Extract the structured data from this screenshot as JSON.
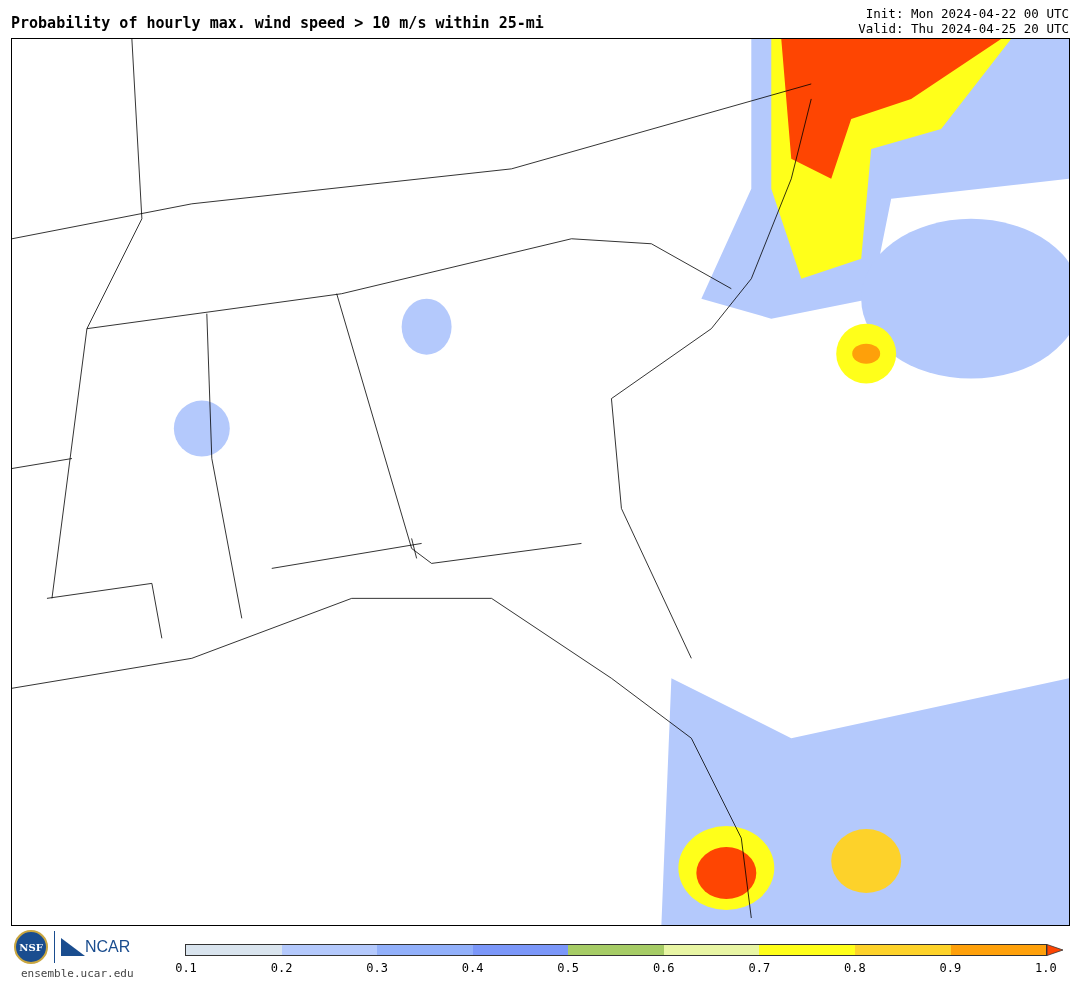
{
  "header": {
    "title": "Probability of hourly max. wind speed > 10 m/s within 25-mi",
    "init": "Init: Mon 2024-04-22 00 UTC",
    "valid": "Valid: Thu 2024-04-25 20 UTC"
  },
  "footer": {
    "logos": [
      "NSF",
      "NCAR"
    ],
    "url": "ensemble.ucar.edu"
  },
  "colorbar": {
    "segments": [
      {
        "color": "#d9e4ee"
      },
      {
        "color": "#b4c9fc"
      },
      {
        "color": "#92b0fa"
      },
      {
        "color": "#7b97f9"
      },
      {
        "color": "#a6cc66"
      },
      {
        "color": "#e8f5a4"
      },
      {
        "color": "#ffff1a"
      },
      {
        "color": "#fdd22a"
      },
      {
        "color": "#fea00a"
      }
    ],
    "extension": {
      "color": "#fe4502"
    },
    "ticks": [
      "0.1",
      "0.2",
      "0.3",
      "0.4",
      "0.5",
      "0.6",
      "0.7",
      "0.8",
      "0.9",
      "1.0"
    ]
  }
}
